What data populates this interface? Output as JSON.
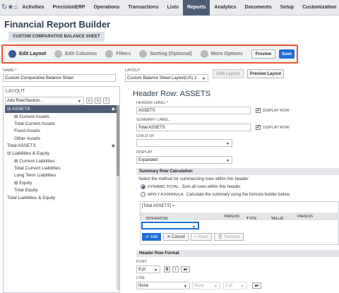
{
  "topnav": {
    "icons": [
      "refresh-icon",
      "star-icon",
      "home-icon"
    ],
    "items": [
      "Activities",
      "PrecisionERP",
      "Operations",
      "Transactions",
      "Lists",
      "Reports",
      "Analytics",
      "Documents",
      "Setup",
      "Customization"
    ],
    "active": "Reports"
  },
  "page": {
    "title": "Financial Report Builder",
    "subtab": "CUSTOM COMPARATIVE BALANCE SHEET"
  },
  "steps": {
    "items": [
      "Edit Layout",
      "Edit Columns",
      "Filters",
      "Sorting (Optional)",
      "More Options"
    ],
    "active": "Edit Layout",
    "preview_label": "Preview",
    "save_label": "Save"
  },
  "name": {
    "label": "NAME",
    "value": "Custom Comparative Balance Sheet"
  },
  "layout_panel": {
    "title": "LAYOUT",
    "add_row": "Add Row/Section...",
    "tree": [
      {
        "label": "⊟ ASSETS",
        "indent": 0,
        "selected": true,
        "eye": true
      },
      {
        "label": "⊞ Current Assets",
        "indent": 1
      },
      {
        "label": "Total Current Assets",
        "indent": 1
      },
      {
        "label": "Fixed Assets",
        "indent": 1
      },
      {
        "label": "Other Assets",
        "indent": 1
      },
      {
        "label": "Total ASSETS",
        "indent": 0,
        "eye": true
      },
      {
        "label": "⊟ Liabilities & Equity",
        "indent": 0
      },
      {
        "label": "⊞ Current Liabilities",
        "indent": 1
      },
      {
        "label": "Total Current Liabilities",
        "indent": 1
      },
      {
        "label": "Long Term Liabilities",
        "indent": 1
      },
      {
        "label": "⊞ Equity",
        "indent": 1
      },
      {
        "label": "Total Equity",
        "indent": 1
      },
      {
        "label": "Total Liabilities & Equity",
        "indent": 0
      }
    ]
  },
  "layout": {
    "label": "LAYOUT",
    "value": "Custom Balance Sheet Layout(US) 2",
    "edit_btn": "Edit Layout",
    "preview_btn": "Preview Layout"
  },
  "header_row": {
    "title": "Header Row: ASSETS",
    "header_label_lbl": "HEADER LABEL",
    "header_label_val": "ASSETS",
    "display_row": "DISPLAY ROW",
    "summary_label_lbl": "SUMMARY LABEL",
    "summary_label_val": "Total ASSETS",
    "child_of_lbl": "CHILD OF",
    "display_lbl": "DISPLAY",
    "display_val": "Expanded"
  },
  "summary_calc": {
    "title": "Summary Row Calculation",
    "desc": "Select the method for summarizing rows within this header:",
    "opt1_key": "DYNAMIC TOTAL:",
    "opt1_txt": "Sum all rows within this header.",
    "opt2_key": "APPLY A FORMULA:",
    "opt2_txt": "Calculate the summary using the formula builder below.",
    "formula": "[Total ASSETS] =",
    "cols": [
      "OPERATOR",
      "PARENS",
      "TYPE",
      "VALUE",
      "PARENS"
    ],
    "add": "Add",
    "cancel": "Cancel",
    "insert": "Insert",
    "remove": "Remove"
  },
  "format": {
    "title": "Header Row Format",
    "font_lbl": "FONT",
    "font_size": "8 pt",
    "line_lbl": "LINE",
    "line_val": "None",
    "line_val2": "None",
    "line_pt": "1 pt"
  },
  "colors": {
    "accent": "#1f6ed4",
    "highlight": "#e8572f",
    "nav_active": "#4d5c75"
  }
}
